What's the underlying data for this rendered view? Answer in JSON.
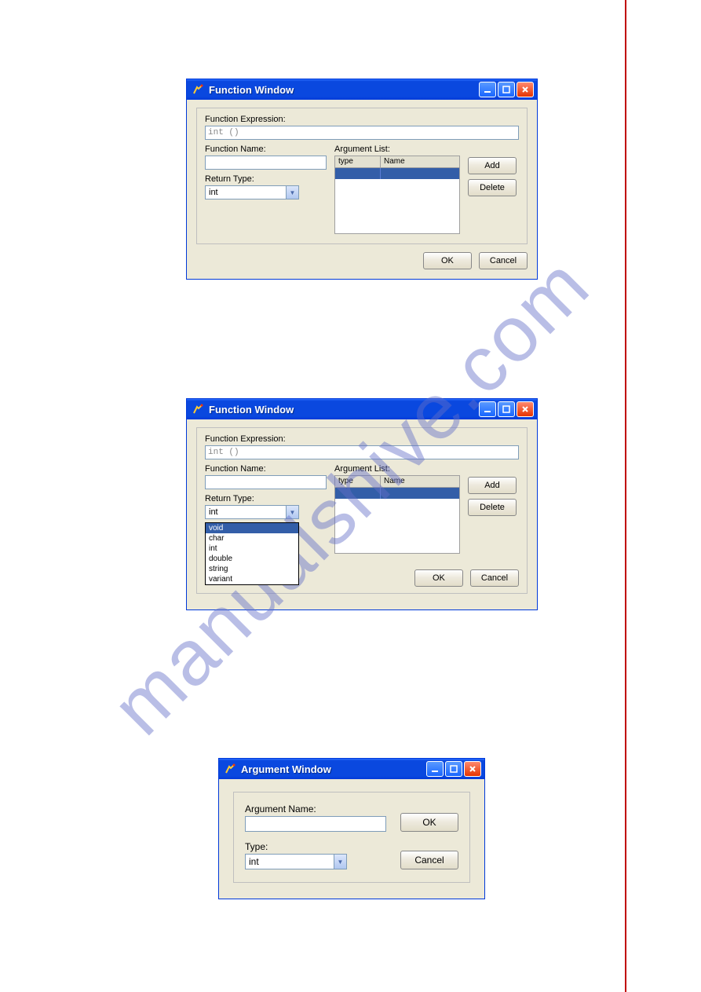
{
  "watermark": "manualshive.com",
  "window1": {
    "title": "Function Window",
    "func_expression_label": "Function Expression:",
    "func_expression_value": "int ()",
    "func_name_label": "Function Name:",
    "func_name_value": "",
    "return_type_label": "Return Type:",
    "return_type_value": "int",
    "argument_list_label": "Argument List:",
    "grid_col_type": "type",
    "grid_col_name": "Name",
    "add_btn": "Add",
    "delete_btn": "Delete",
    "ok_btn": "OK",
    "cancel_btn": "Cancel"
  },
  "window2": {
    "title": "Function Window",
    "func_expression_label": "Function Expression:",
    "func_expression_value": "int ()",
    "func_name_label": "Function Name:",
    "func_name_value": "",
    "return_type_label": "Return Type:",
    "return_type_value": "int",
    "return_type_options": [
      "void",
      "char",
      "int",
      "double",
      "string",
      "variant"
    ],
    "return_type_selected_index": 0,
    "argument_list_label": "Argument List:",
    "grid_col_type": "type",
    "grid_col_name": "Name",
    "add_btn": "Add",
    "delete_btn": "Delete",
    "ok_btn": "OK",
    "cancel_btn": "Cancel"
  },
  "window3": {
    "title": "Argument Window",
    "argument_name_label": "Argument Name:",
    "argument_name_value": "",
    "type_label": "Type:",
    "type_value": "int",
    "ok_btn": "OK",
    "cancel_btn": "Cancel"
  }
}
